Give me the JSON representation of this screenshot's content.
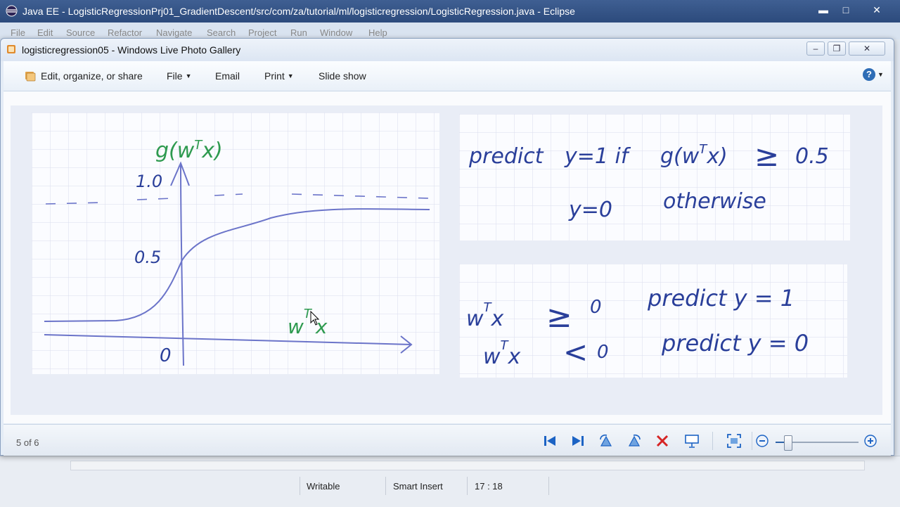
{
  "eclipse": {
    "title": "Java EE - LogisticRegressionPrj01_GradientDescent/src/com/za/tutorial/ml/logisticregression/LogisticRegression.java - Eclipse",
    "menu": [
      "File",
      "Edit",
      "Source",
      "Refactor",
      "Navigate",
      "Search",
      "Project",
      "Run",
      "Window",
      "Help"
    ],
    "status": {
      "writable": "Writable",
      "insert_mode": "Smart Insert",
      "position": "17 : 18"
    }
  },
  "gallery": {
    "title": "logisticregression05 - Windows Live Photo Gallery",
    "toolbar": {
      "edit_label": "Edit, organize, or share",
      "file_label": "File",
      "email_label": "Email",
      "print_label": "Print",
      "slideshow_label": "Slide show",
      "help_label": "?"
    },
    "counter": "5 of 6",
    "zoom_level": 0.15
  },
  "slide": {
    "graph": {
      "y_label_main": "g(w",
      "y_label_sup": "T",
      "y_label_end": "x)",
      "tick_top": "1.0",
      "tick_mid": "0.5",
      "origin": "0",
      "x_label_w": "w",
      "x_label_sup": "T",
      "x_label_x": "x"
    },
    "rule1": {
      "predict": "predict",
      "cond": "y=1  if",
      "expr": "g(w",
      "expr_sup": "T",
      "expr_end": "x)",
      "geq": "≥",
      "threshold": "0.5",
      "else_val": "y=0",
      "otherwise": "otherwise"
    },
    "rule2": {
      "line1_lhs": "w",
      "line1_sup": "T",
      "line1_x": "x",
      "line1_op": "≥",
      "line1_zero": "0",
      "line1_predict": "predict  y = 1",
      "line2_lhs": "w",
      "line2_sup": "T",
      "line2_x": "x",
      "line2_op": "<",
      "line2_zero": "0",
      "line2_predict": "predict  y = 0"
    }
  },
  "colors": {
    "ink_blue": "#2a3f9a",
    "ink_green": "#2e9a4f",
    "curve_blue": "#6b74c9",
    "eclipse_titlebar": "#2c4a7c"
  }
}
